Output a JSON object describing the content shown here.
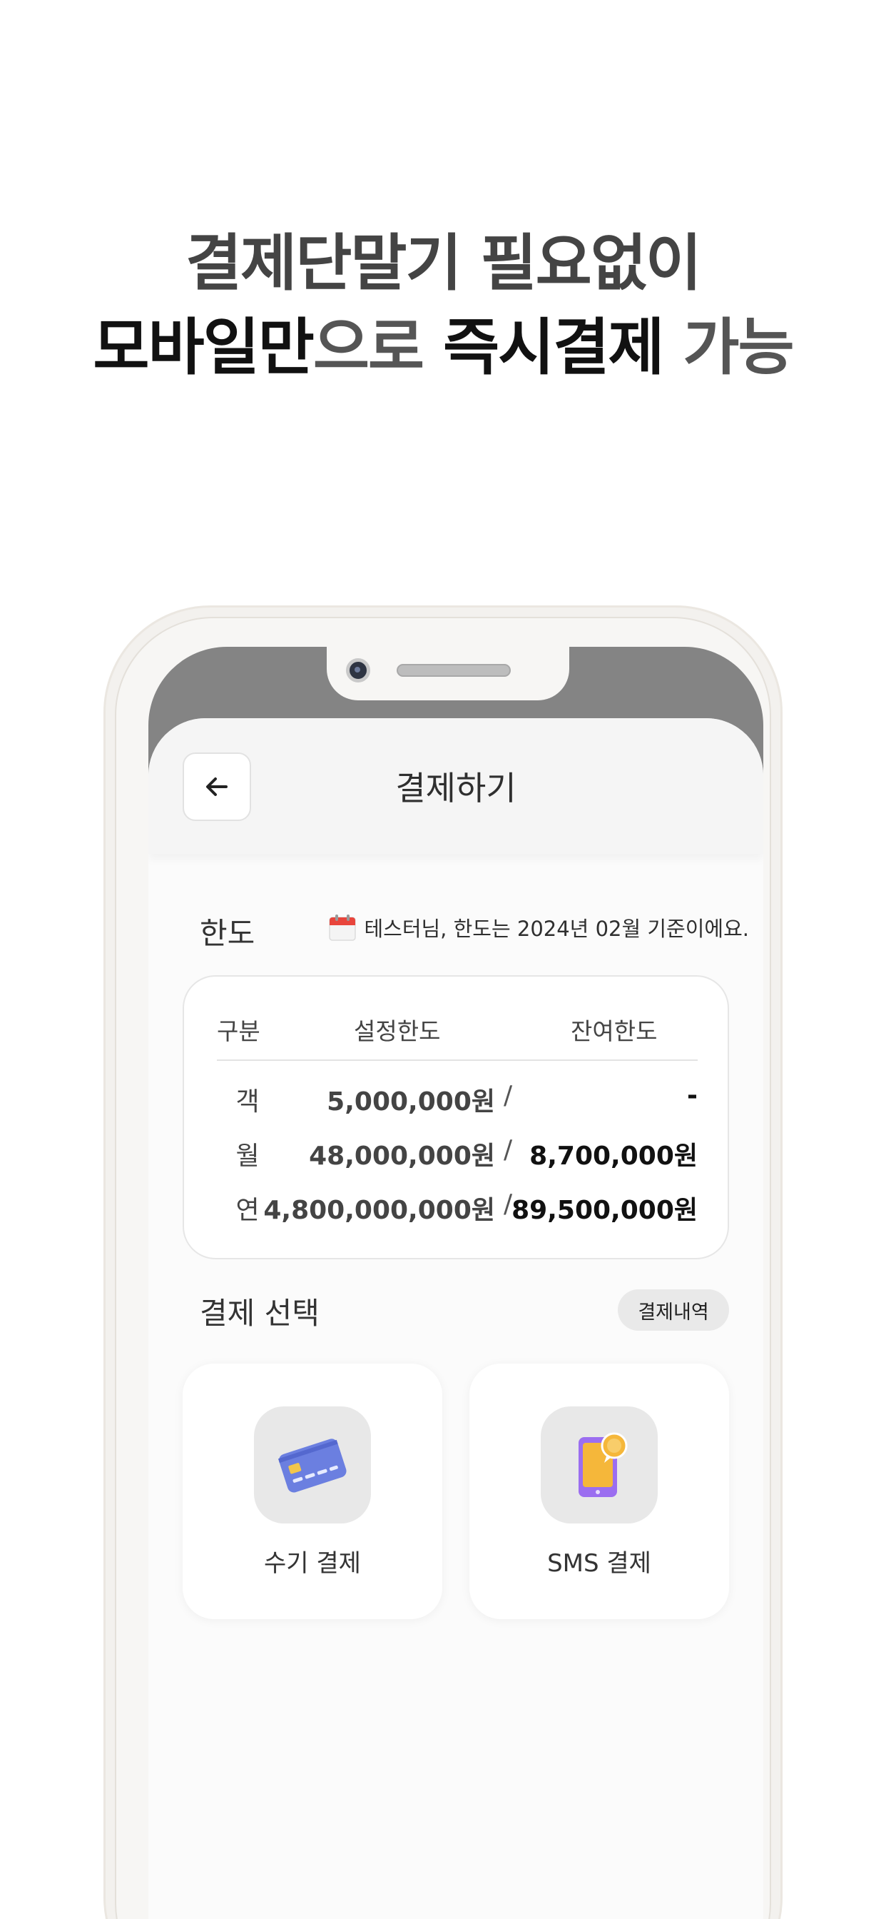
{
  "headline": {
    "line1": "결제단말기 필요없이",
    "line2_part1": "모바일만",
    "line2_part2": "으로 ",
    "line2_part3": "즉시결제",
    "line2_part4": " 가능"
  },
  "header": {
    "title": "결제하기",
    "back_icon": "arrow-left-icon"
  },
  "limit": {
    "label": "한도",
    "note": "테스터님, 한도는 2024년 02월 기준이에요.",
    "note_icon": "calendar-icon",
    "columns": [
      "구분",
      "설정한도",
      "잔여한도"
    ],
    "rows": [
      {
        "category": "객",
        "set": "5,000,000원",
        "separator": "/",
        "remaining": "-"
      },
      {
        "category": "월",
        "set": "48,000,000원",
        "separator": "/",
        "remaining": "8,700,000원"
      },
      {
        "category": "연",
        "set": "4,800,000,000원",
        "separator": "/",
        "remaining": "89,500,000원"
      }
    ]
  },
  "payment": {
    "label": "결제 선택",
    "history_button": "결제내역",
    "options": [
      {
        "label": "수기 결제",
        "icon": "credit-card-icon"
      },
      {
        "label": "SMS 결제",
        "icon": "mobile-message-icon"
      }
    ]
  },
  "colors": {
    "background": "#ffffff",
    "phone_bezel": "#848484",
    "app_background": "#fbfbfb",
    "card_icon_blue": "#6b7fe0",
    "card_chip_yellow": "#f2c64b",
    "phone_icon_purple": "#9b6ef0",
    "phone_icon_orange": "#f5b73a"
  }
}
